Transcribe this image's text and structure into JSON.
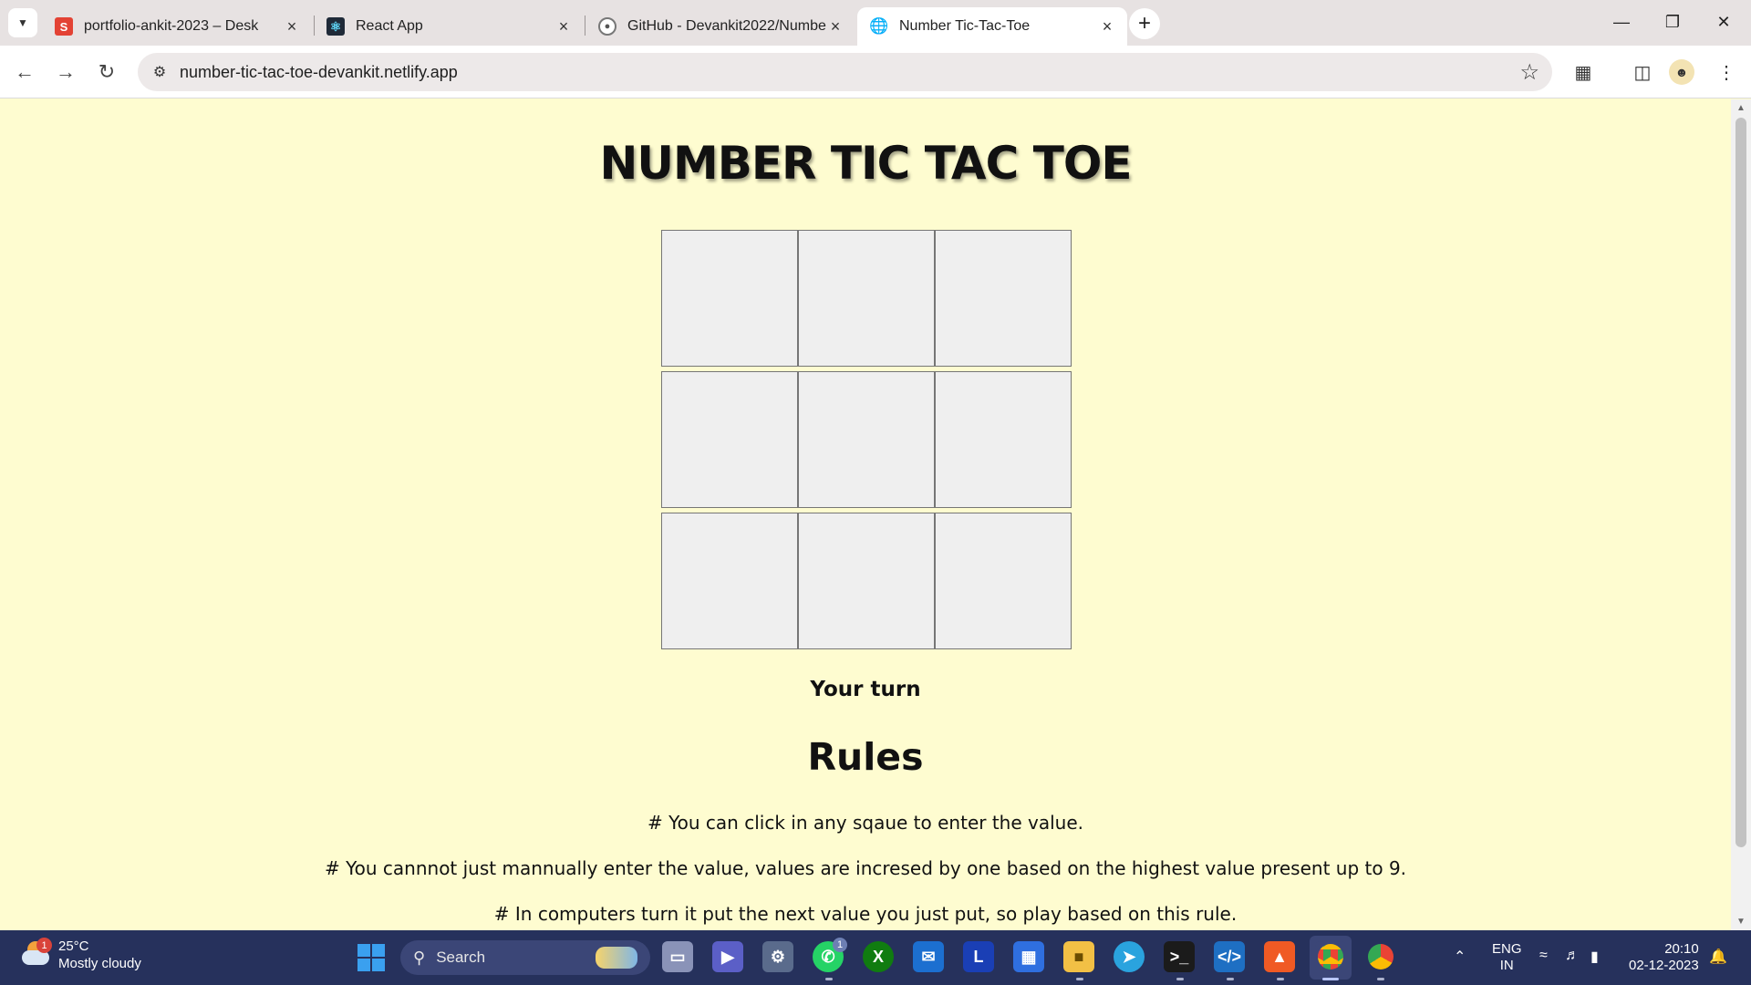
{
  "browser": {
    "tabs": [
      {
        "title": "portfolio-ankit-2023 – Desk",
        "favicon": "S",
        "active": false
      },
      {
        "title": "React App",
        "favicon": "react-icon",
        "active": false
      },
      {
        "title": "GitHub - Devankit2022/Numbe",
        "favicon": "github-icon",
        "active": false
      },
      {
        "title": "Number Tic-Tac-Toe",
        "favicon": "globe-icon",
        "active": true
      }
    ],
    "url": "number-tic-tac-toe-devankit.netlify.app"
  },
  "game": {
    "title": "NUMBER TIC TAC TOE",
    "board": [
      "",
      "",
      "",
      "",
      "",
      "",
      "",
      "",
      ""
    ],
    "status": "Your turn",
    "rules_heading": "Rules",
    "rules": [
      "# You can click in any sqaue to enter the value.",
      "# You cannnot just mannually enter the value, values are incresed by one based on the highest value present up to 9.",
      "# In computers turn it put the next value you just put, so play based on this rule."
    ]
  },
  "taskbar": {
    "weather": {
      "temp": "25°C",
      "condition": "Mostly cloudy",
      "badge": "1"
    },
    "search_label": "Search",
    "whatsapp_badge": "1",
    "language": {
      "line1": "ENG",
      "line2": "IN"
    },
    "clock": {
      "time": "20:10",
      "date": "02-12-2023"
    }
  },
  "colors": {
    "page_bg": "#fefcd0",
    "cell_bg": "#efefef",
    "taskbar_bg": "#26315c"
  }
}
